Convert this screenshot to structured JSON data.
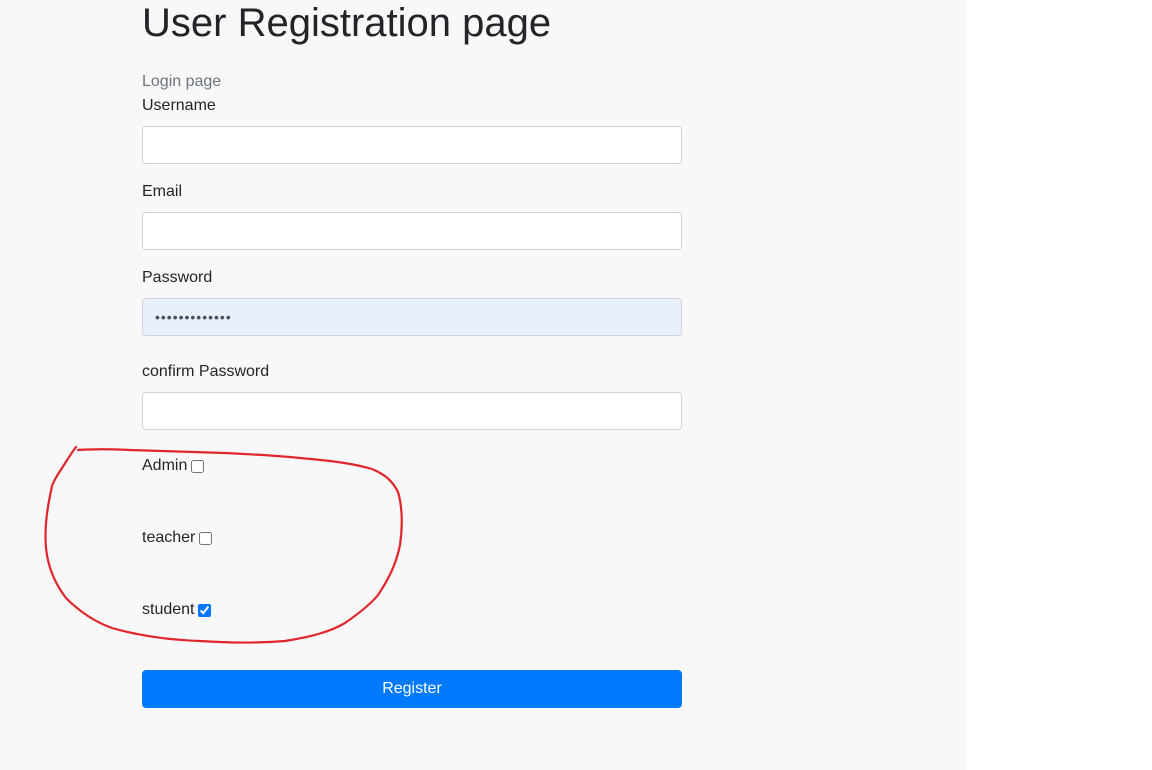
{
  "header": {
    "title": "User Registration page"
  },
  "nav": {
    "login_link": "Login page"
  },
  "form": {
    "username": {
      "label": "Username",
      "value": ""
    },
    "email": {
      "label": "Email",
      "value": ""
    },
    "password": {
      "label": "Password",
      "value": "•••••••••••••"
    },
    "confirm_password": {
      "label": "confirm Password",
      "value": ""
    },
    "roles": [
      {
        "label": "Admin",
        "checked": false
      },
      {
        "label": "teacher",
        "checked": false
      },
      {
        "label": "student",
        "checked": true
      }
    ],
    "submit_label": "Register"
  },
  "colors": {
    "panel_bg": "#f8f8f8",
    "primary_button": "#007bff",
    "autofill_bg": "#e8f0fe",
    "annotation_stroke": "#e0262b"
  }
}
